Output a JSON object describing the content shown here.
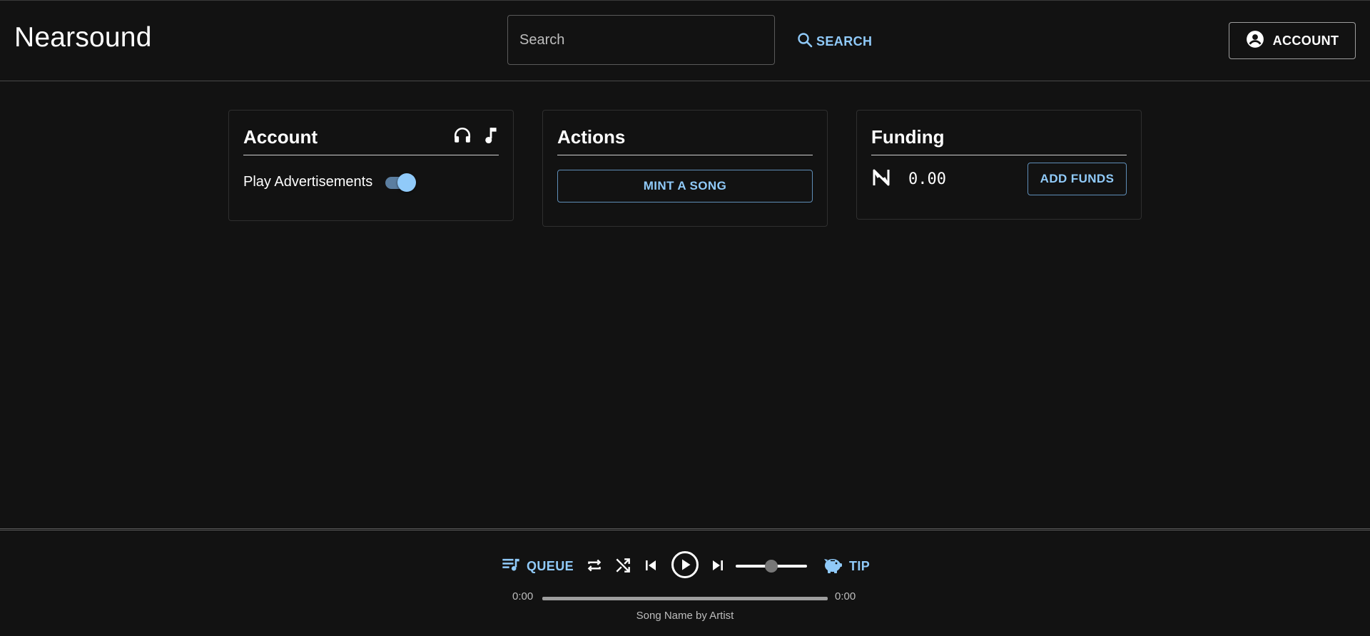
{
  "app": {
    "title": "Nearsound"
  },
  "header": {
    "search_placeholder": "Search",
    "search_button": "SEARCH",
    "account_button": "ACCOUNT"
  },
  "cards": {
    "account": {
      "title": "Account",
      "icons": [
        "headphones-icon",
        "music-note-icon"
      ],
      "toggle_label": "Play Advertisements",
      "toggle_on": true
    },
    "actions": {
      "title": "Actions",
      "mint_button": "MINT A SONG"
    },
    "funding": {
      "title": "Funding",
      "currency_icon": "near-logo-icon",
      "amount": "0.00",
      "add_button": "ADD FUNDS"
    }
  },
  "player": {
    "queue_label": "QUEUE",
    "tip_label": "TIP",
    "current_time": "0:00",
    "total_time": "0:00",
    "volume_level": 0.5,
    "song_info": "Song Name by Artist"
  },
  "colors": {
    "background": "#121212",
    "accent": "#90caf9",
    "text": "#ffffff"
  }
}
